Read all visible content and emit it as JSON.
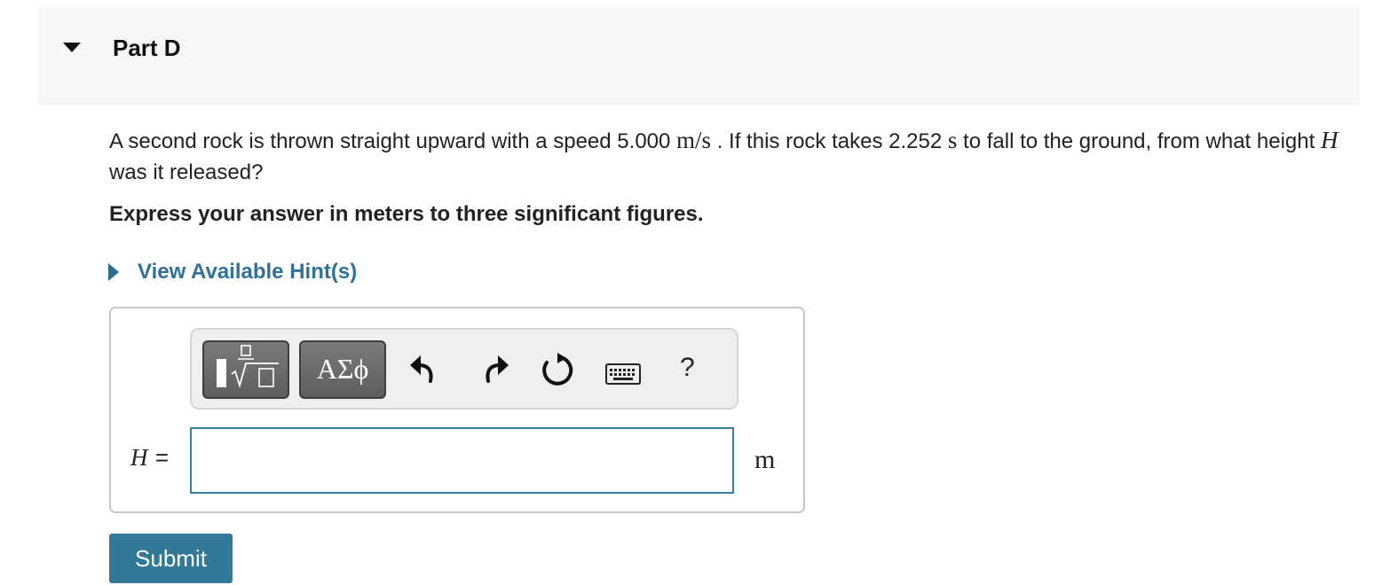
{
  "part": {
    "title": "Part D"
  },
  "question": {
    "t1": "A second rock is thrown straight upward with a speed 5.000",
    "speed_unit": "m/s",
    "t2": ". If this rock takes 2.252",
    "time_unit": "s",
    "t3": "to fall to the ground, from what height",
    "variable": "H",
    "t4": "was it released?"
  },
  "instruction": "Express your answer in meters to three significant figures.",
  "hint": {
    "label": "View Available Hint(s)"
  },
  "toolbar": {
    "templates_icon": "fraction-sqrt-template-icon",
    "greek_label": "ΑΣϕ",
    "undo_icon": "undo-icon",
    "redo_icon": "redo-icon",
    "reset_icon": "reset-icon",
    "keyboard_icon": "keyboard-icon",
    "help_label": "?"
  },
  "answer": {
    "variable_label": "H =",
    "value": "",
    "unit": "m"
  },
  "submit_label": "Submit",
  "colors": {
    "accent": "#327998",
    "link": "#2f7197",
    "input_border": "#3a7ea5"
  }
}
